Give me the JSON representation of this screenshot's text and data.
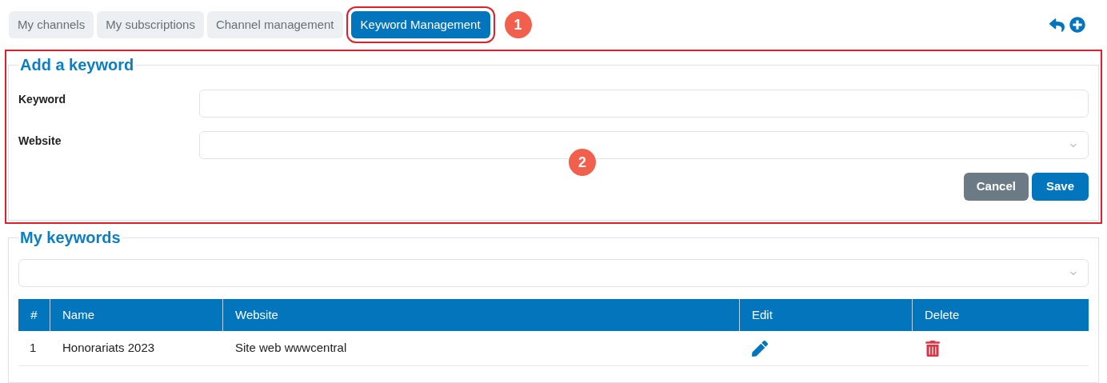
{
  "tabs": [
    {
      "label": "My channels",
      "selected": false
    },
    {
      "label": "My subscriptions",
      "selected": false
    },
    {
      "label": "Channel management",
      "selected": false
    },
    {
      "label": "Keyword Management",
      "selected": true
    }
  ],
  "annotations": [
    {
      "number": "1"
    },
    {
      "number": "2"
    }
  ],
  "add_form": {
    "legend": "Add a keyword",
    "fields": [
      {
        "label": "Keyword",
        "kind": "text"
      },
      {
        "label": "Website",
        "kind": "select"
      }
    ],
    "buttons": [
      {
        "label": "Cancel",
        "kind": "secondary"
      },
      {
        "label": "Save",
        "kind": "primary"
      }
    ]
  },
  "keywords": {
    "legend": "My keywords",
    "columns": [
      "#",
      "Name",
      "Website",
      "Edit",
      "Delete"
    ],
    "rows": [
      {
        "index": "1",
        "name": "Honorariats 2023",
        "website": "Site web wwwcentral"
      }
    ]
  }
}
